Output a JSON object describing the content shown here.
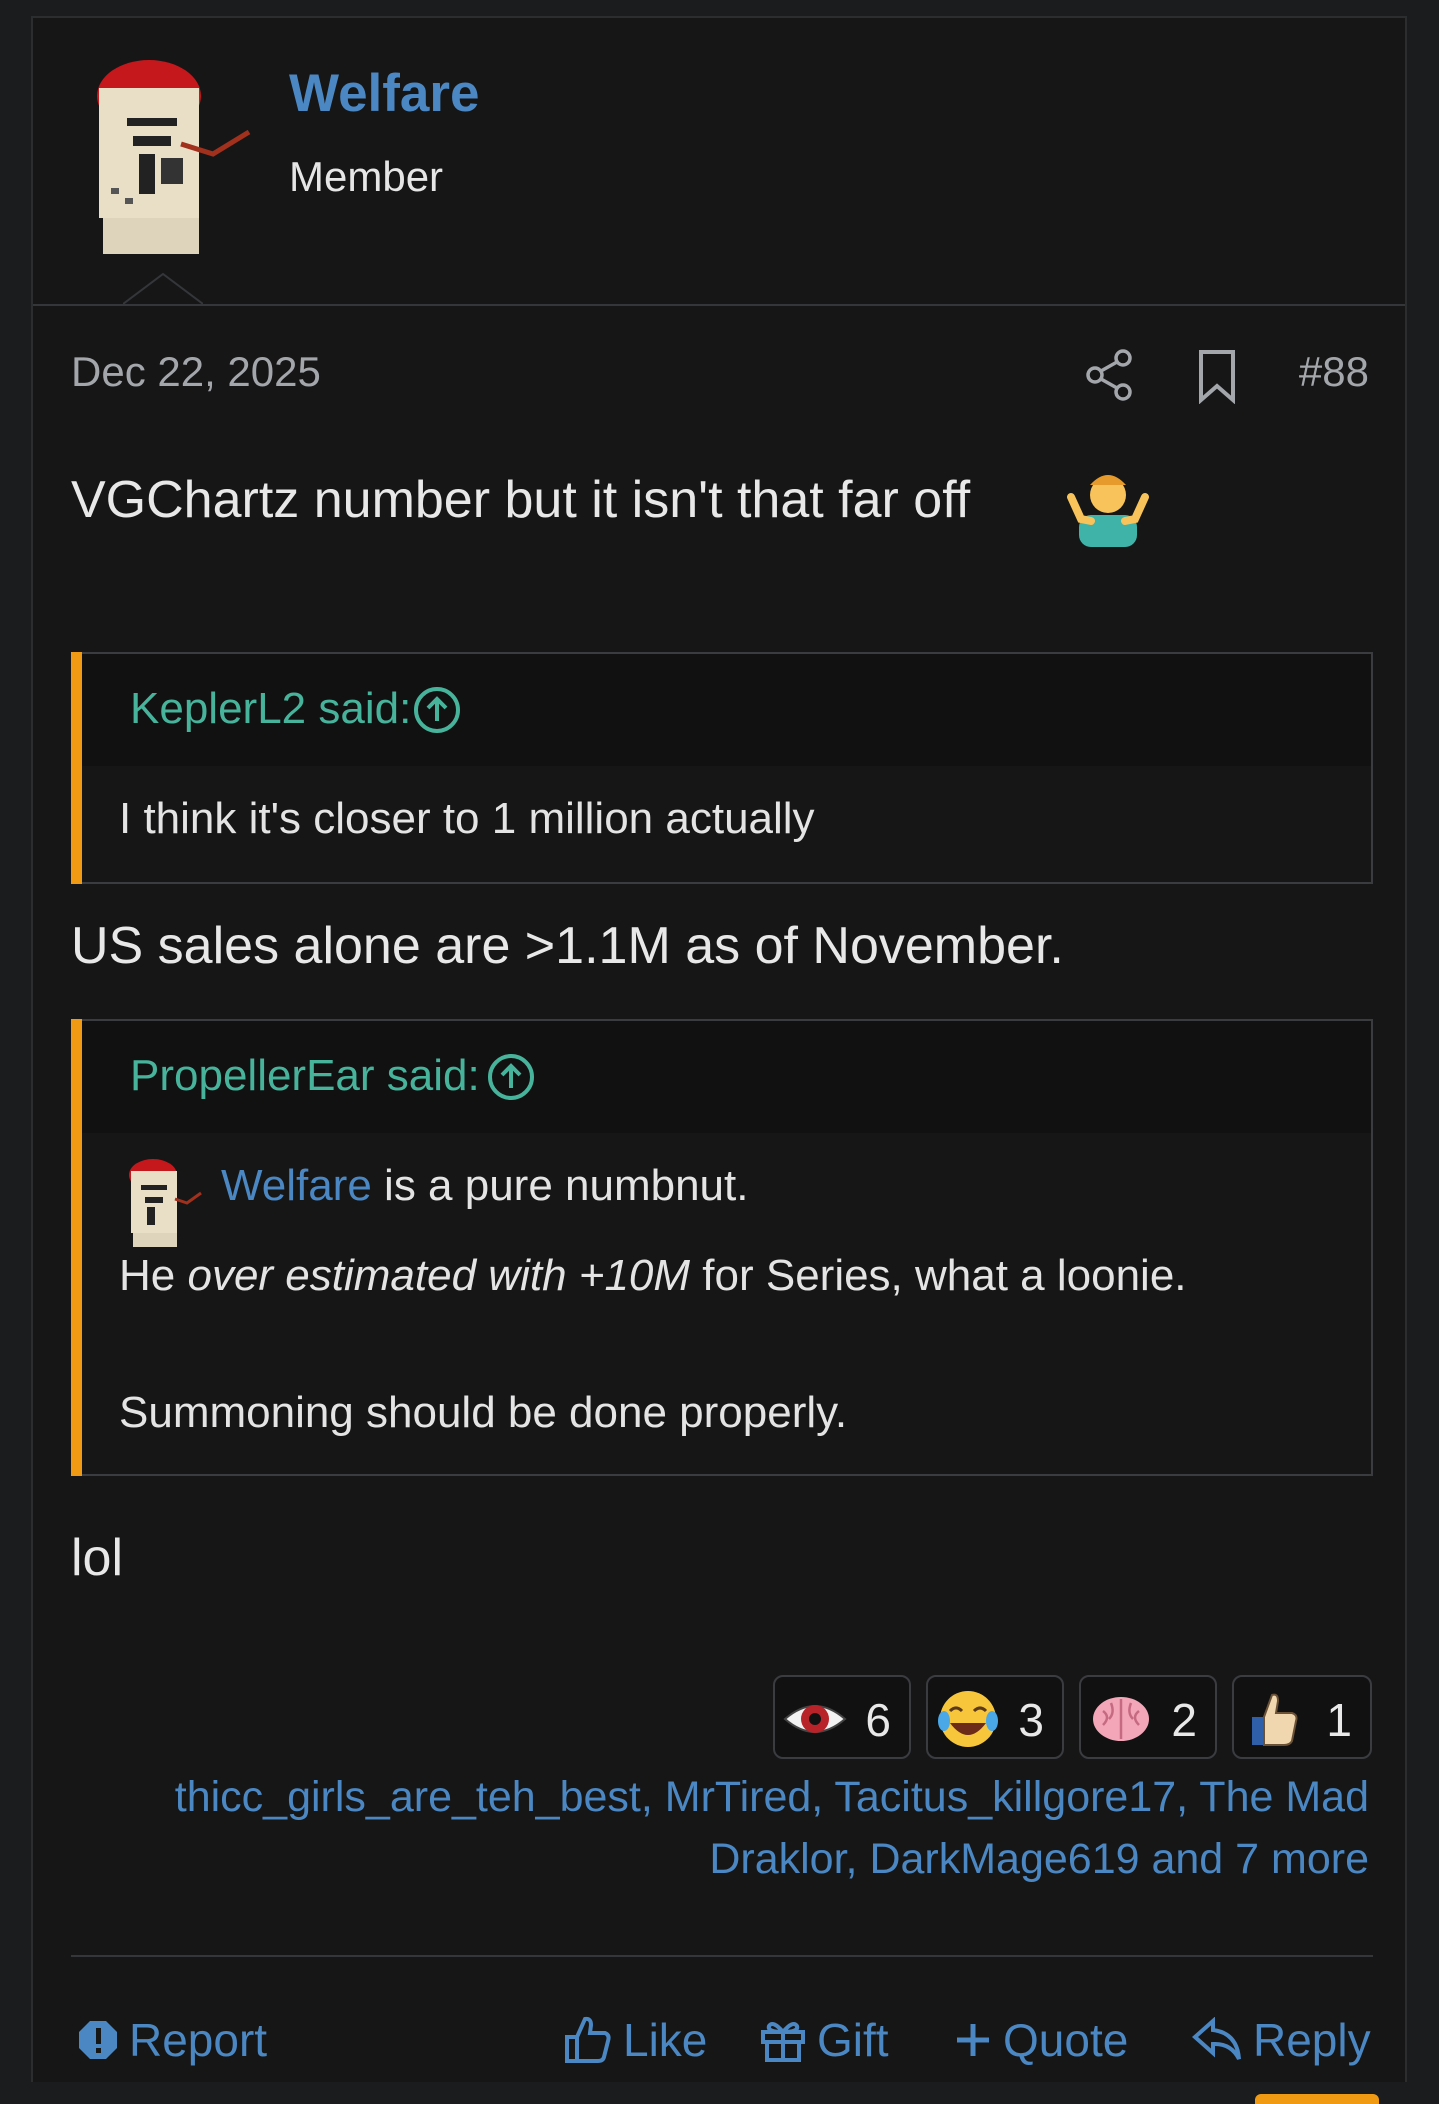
{
  "user": {
    "name": "Welfare",
    "title": "Member"
  },
  "post": {
    "date": "Dec 22, 2025",
    "number": "#88",
    "line1": "VGChartz number but it isn't that far off",
    "line1_emoji": "person-shrugging-emoji",
    "line2": "US sales alone are >1.1M as of November.",
    "line3": "lol"
  },
  "quotes": [
    {
      "author": "KeplerL2 said:",
      "body": "I think it's closer to 1 million actually"
    },
    {
      "author": "PropellerEar said:",
      "mention": "Welfare",
      "mention_rest": " is a pure numbnut.",
      "line2_a": "He ",
      "line2_italic": "over estimated with +10M",
      "line2_b": " for Series, what a loonie.",
      "line3": "Summoning should be done properly."
    }
  ],
  "reactions": [
    {
      "icon": "eye-icon",
      "count": "6"
    },
    {
      "icon": "laughing-tears-icon",
      "count": "3"
    },
    {
      "icon": "brain-icon",
      "count": "2"
    },
    {
      "icon": "thumbs-up-icon",
      "count": "1"
    }
  ],
  "reactors": {
    "line1": "thicc_girls_are_teh_best, MrTired, Tacitus_killgore17, The Mad",
    "line2": "Draklor, DarkMage619 and 7 more"
  },
  "actions": {
    "report": "Report",
    "like": "Like",
    "gift": "Gift",
    "quote": "Quote",
    "reply": "Reply"
  },
  "colors": {
    "accent_blue": "#4b87c2",
    "quote_green": "#47b39b",
    "quote_bar": "#f09a14",
    "background": "#161617"
  }
}
